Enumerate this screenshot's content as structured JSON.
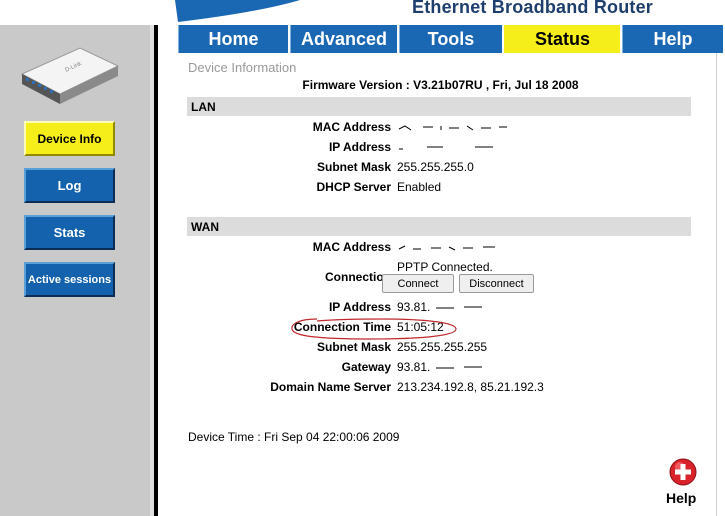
{
  "brand": {
    "title": "Ethernet Broadband Router"
  },
  "sidebar": {
    "items": [
      {
        "label": "Device Info",
        "active": true
      },
      {
        "label": "Log",
        "active": false
      },
      {
        "label": "Stats",
        "active": false
      },
      {
        "label": "Active sessions",
        "active": false
      }
    ]
  },
  "tabs": [
    {
      "label": "Home",
      "active": false
    },
    {
      "label": "Advanced",
      "active": false
    },
    {
      "label": "Tools",
      "active": false
    },
    {
      "label": "Status",
      "active": true
    },
    {
      "label": "Help",
      "active": false
    }
  ],
  "page": {
    "section_title": "Device Information",
    "firmware": "Firmware Version : V3.21b07RU , Fri, Jul 18 2008",
    "lan": {
      "header": "LAN",
      "rows": [
        {
          "label": "MAC Address",
          "value": ""
        },
        {
          "label": "IP Address",
          "value": ""
        },
        {
          "label": "Subnet Mask",
          "value": "255.255.255.0"
        },
        {
          "label": "DHCP Server",
          "value": "Enabled"
        }
      ]
    },
    "wan": {
      "header": "WAN",
      "mac_label": "MAC Address",
      "mac_value": "",
      "connection_label": "Connection",
      "connection_value": "PPTP Connected.",
      "connect_btn": "Connect",
      "disconnect_btn": "Disconnect",
      "ip_label": "IP Address",
      "ip_value": "93.81.",
      "conn_time_label": "Connection Time",
      "conn_time_value": "51:05:12",
      "subnet_label": "Subnet Mask",
      "subnet_value": "255.255.255.255",
      "gateway_label": "Gateway",
      "gateway_value": "93.81.",
      "dns_label": "Domain Name Server",
      "dns_value": "213.234.192.8, 85.21.192.3"
    },
    "device_time": "Device Time : Fri Sep 04 22:00:06 2009",
    "help_label": "Help"
  },
  "colors": {
    "tab_blue": "#1a67b3",
    "active_yellow": "#f5ee1a",
    "brand_navy": "#1e3f6e",
    "annotation_red": "#c0282e"
  },
  "icons": [
    "router-icon",
    "help-plus-icon"
  ]
}
